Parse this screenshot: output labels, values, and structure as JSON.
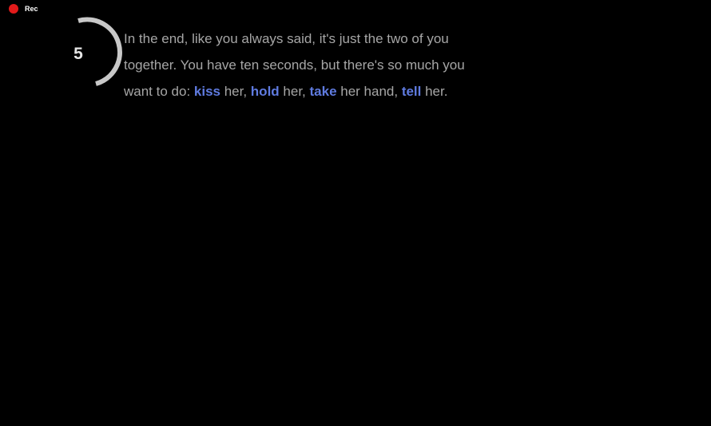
{
  "recording": {
    "label": "Rec",
    "dot_color": "#e21a1a"
  },
  "timer": {
    "seconds_left": "5",
    "total_seconds": 10,
    "ring_color": "#c8c8c8"
  },
  "story": {
    "intro": "In the end, like you always said, it's just the two of you together. You have ten seconds, but there's so much you want to do: ",
    "actions": [
      {
        "word": "kiss",
        "after": " her, "
      },
      {
        "word": "hold",
        "after": " her, "
      },
      {
        "word": "take",
        "after": " her hand, "
      },
      {
        "word": "tell",
        "after": " her."
      }
    ],
    "text_color": "#a6a6a6",
    "action_color": "#5f7be0"
  }
}
